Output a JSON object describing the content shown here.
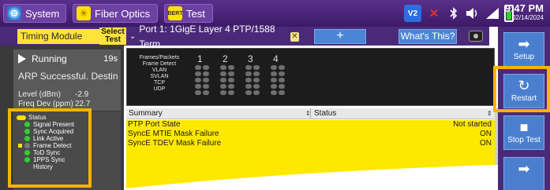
{
  "topbar": {
    "tabs": [
      {
        "label": "System",
        "icon": "gear-icon"
      },
      {
        "label": "Fiber Optics",
        "icon": "fiber-optics-icon"
      },
      {
        "label": "Test",
        "icon": "test-icon",
        "icon_text": "BERT"
      }
    ],
    "status_icons": [
      "v2-icon",
      "error-x-icon",
      "bluetooth-icon",
      "volume-icon",
      "wifi-icon",
      "battery-icon"
    ],
    "v2_label": "V2",
    "time": "9:47 PM",
    "date": "02/14/2024"
  },
  "toolbar": {
    "module_label": "Timing Module",
    "select_test_label": "Select Test",
    "port_label": "Port 1: 1GigE Layer 4 PTP/1588 Term",
    "add_label": "+",
    "whats_this_label": "What's This?",
    "camera_icon": "camera-icon"
  },
  "left": {
    "run_status": "Running",
    "run_seconds": "19s",
    "arp_message": "ARP Successful. Destin",
    "level_label": "Level (dBm)",
    "level_value": "-2.9",
    "freq_label": "Freq Dev (ppm)",
    "freq_value": "22.7",
    "legend": [
      {
        "label": "Status",
        "marker": "yellow-pill",
        "dot": "none"
      },
      {
        "label": "Signal Present",
        "marker": "none",
        "dot": "green"
      },
      {
        "label": "Sync Acquired",
        "marker": "none",
        "dot": "green"
      },
      {
        "label": "Link Active",
        "marker": "none",
        "dot": "green"
      },
      {
        "label": "Frame Detect",
        "marker": "yellow-square",
        "dot": "gray"
      },
      {
        "label": "ToD Sync",
        "marker": "none",
        "dot": "green"
      },
      {
        "label": "1PPS Sync",
        "marker": "none",
        "dot": "green"
      },
      {
        "label": "History",
        "marker": "none",
        "dot": "none"
      }
    ]
  },
  "frames": {
    "header": "Frames/Packets",
    "rows": [
      "Frame Detect",
      "VLAN",
      "SVLAN",
      "TCP",
      "UDP"
    ],
    "columns": [
      "1",
      "2",
      "3",
      "4"
    ]
  },
  "table": {
    "col_summary": "Summary",
    "col_status": "Status",
    "rows": [
      {
        "name": "PTP Port State",
        "value": "Not started"
      },
      {
        "name": "SyncE MTIE Mask Failure",
        "value": "ON"
      },
      {
        "name": "SyncE TDEV Mask Failure",
        "value": "ON"
      }
    ]
  },
  "actions": [
    {
      "label": "Setup",
      "icon": "arrow-right-icon"
    },
    {
      "label": "Restart",
      "icon": "restart-icon"
    },
    {
      "label": "Stop Test",
      "icon": "stop-icon"
    },
    {
      "label": "",
      "icon": "arrow-right-icon"
    }
  ],
  "colors": {
    "purple_bar": "#4a2a78",
    "accent_blue": "#4a7fd0",
    "highlight": "#f6b400",
    "yellow": "#ffe800",
    "green": "#2ed130"
  }
}
